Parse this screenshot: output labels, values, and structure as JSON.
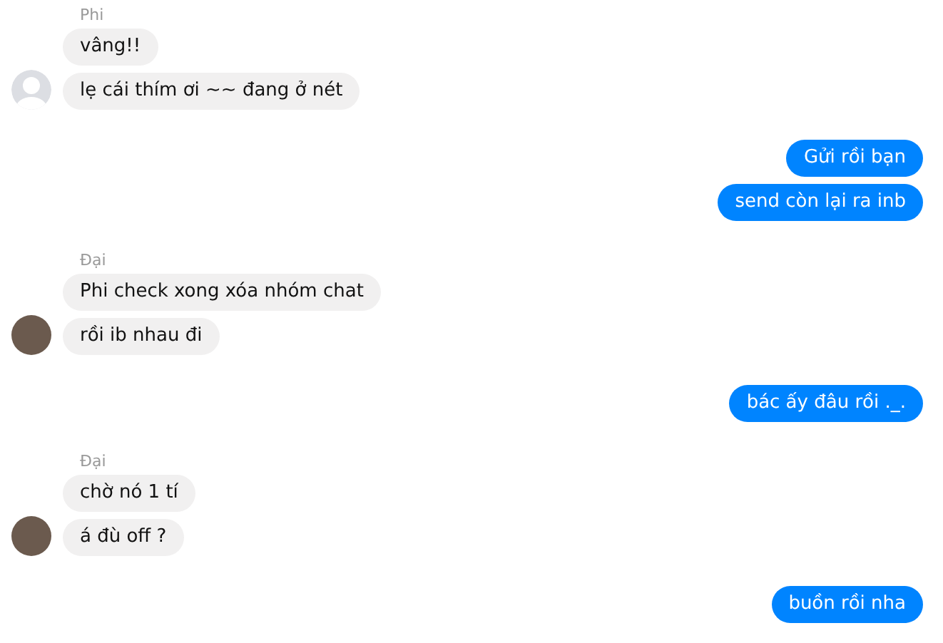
{
  "conversation": [
    {
      "kind": "incoming",
      "sender": "Phi",
      "avatar": {
        "kind": "silhouette"
      },
      "messages": [
        "vâng!!",
        "lẹ cái thím ơi ~~ đang ở nét"
      ]
    },
    {
      "kind": "outgoing",
      "messages": [
        "Gửi rồi bạn",
        "send còn lại ra inb"
      ]
    },
    {
      "kind": "incoming",
      "sender": "Đại",
      "avatar": {
        "kind": "photo"
      },
      "messages": [
        "Phi check xong xóa nhóm chat",
        "rồi ib nhau đi"
      ]
    },
    {
      "kind": "outgoing",
      "messages": [
        "bác ấy đâu rồi ._."
      ]
    },
    {
      "kind": "incoming",
      "sender": "Đại",
      "avatar": {
        "kind": "photo"
      },
      "messages": [
        "chờ nó 1 tí",
        "á đù off ?"
      ]
    },
    {
      "kind": "outgoing",
      "messages": [
        "buồn rồi nha"
      ]
    }
  ]
}
